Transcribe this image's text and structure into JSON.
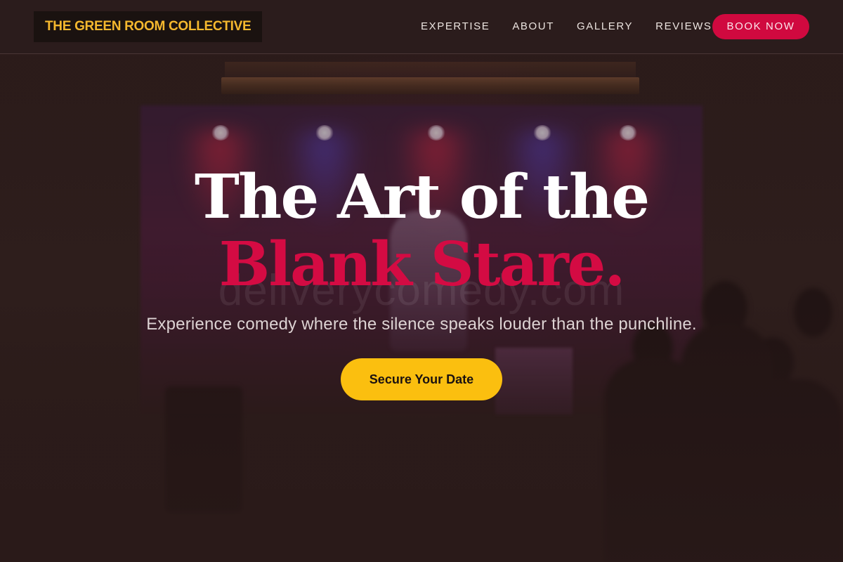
{
  "brand": {
    "name": "THE GREEN ROOM COLLECTIVE"
  },
  "nav": {
    "links": [
      "EXPERTISE",
      "ABOUT",
      "GALLERY",
      "REVIEWS"
    ],
    "cta_label": "BOOK NOW"
  },
  "hero": {
    "headline_line1": "The Art of the",
    "headline_line2": "Blank Stare.",
    "watermark": "deliverycomedy.com",
    "tagline": "Experience comedy where the silence speaks louder than the punchline.",
    "cta_label": "Secure Your Date"
  },
  "colors": {
    "background": "#2b1b1a",
    "brand_text": "#f5b82e",
    "accent_red": "#d0093f",
    "cta_yellow": "#fbbf0f",
    "headline_white": "#ffffff"
  }
}
